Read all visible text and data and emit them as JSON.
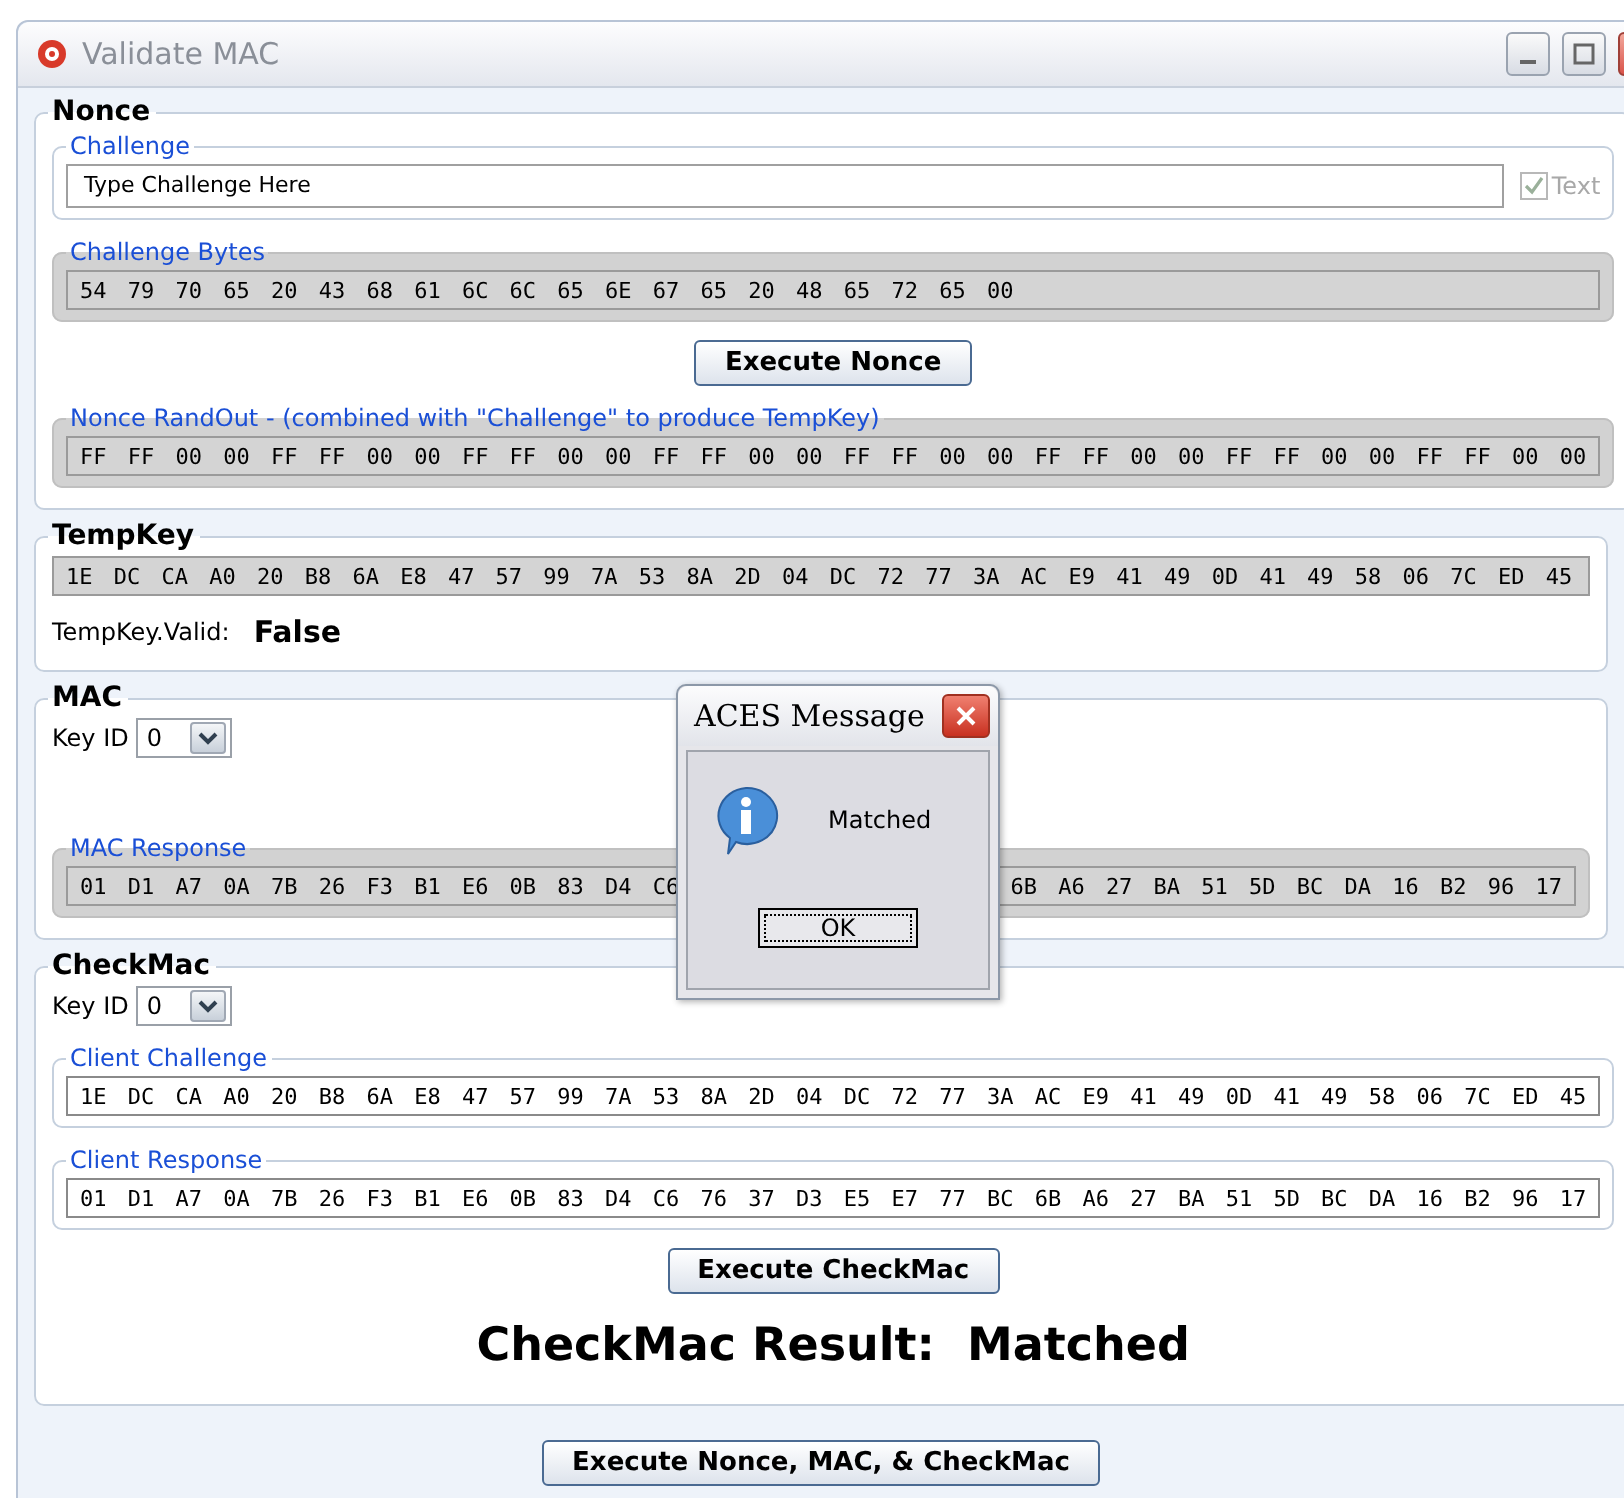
{
  "window": {
    "title": "Validate MAC"
  },
  "nonce": {
    "title": "Nonce",
    "challenge": {
      "label": "Challenge",
      "value": "Type Challenge Here",
      "text_option": {
        "label": "Text",
        "checked": true,
        "disabled": true
      }
    },
    "challenge_bytes": {
      "label": "Challenge Bytes",
      "value": "54 79 70 65 20 43 68 61 6C 6C 65 6E 67 65 20 48 65 72 65 00",
      "readonly": true
    },
    "execute_button": "Execute Nonce",
    "rand_out": {
      "label": "Nonce RandOut - (combined with \"Challenge\" to produce TempKey)",
      "value": "FF FF 00 00 FF FF 00 00 FF FF 00 00 FF FF 00 00 FF FF 00 00 FF FF 00 00 FF FF 00 00 FF FF 00 00",
      "readonly": true
    }
  },
  "tempkey": {
    "title": "TempKey",
    "value": "1E DC CA A0 20 B8 6A E8 47 57 99 7A 53 8A 2D 04 DC 72 77 3A AC E9 41 49 0D 41 49 58 06 7C ED 45",
    "readonly": true,
    "valid_label": "TempKey.Valid:",
    "valid_value": "False"
  },
  "mac": {
    "title": "MAC",
    "key_id": {
      "label": "Key ID",
      "value": "0"
    },
    "response": {
      "label": "MAC Response",
      "value_start": "01 D1 A7 0A 7B 26 F3 B1 E6 0B 83 D4 C6",
      "value_end": "6B A6 27 BA 51 5D BC DA 16 B2 96 17",
      "readonly": true
    }
  },
  "checkmac": {
    "title": "CheckMac",
    "key_id": {
      "label": "Key ID",
      "value": "0"
    },
    "client_challenge": {
      "label": "Client Challenge",
      "value": "1E DC CA A0 20 B8 6A E8 47 57 99 7A 53 8A 2D 04 DC 72 77 3A AC E9 41 49 0D 41 49 58 06 7C ED 45",
      "readonly": false
    },
    "client_response": {
      "label": "Client Response",
      "value": "01 D1 A7 0A 7B 26 F3 B1 E6 0B 83 D4 C6 76 37 D3 E5 E7 77 BC 6B A6 27 BA 51 5D BC DA 16 B2 96 17",
      "readonly": false
    },
    "execute_button": "Execute CheckMac",
    "result_label": "CheckMac Result:",
    "result_value": "Matched"
  },
  "run_all_button": "Execute Nonce, MAC, & CheckMac",
  "dialog": {
    "title": "ACES Message",
    "message": "Matched",
    "ok_button": "OK"
  }
}
